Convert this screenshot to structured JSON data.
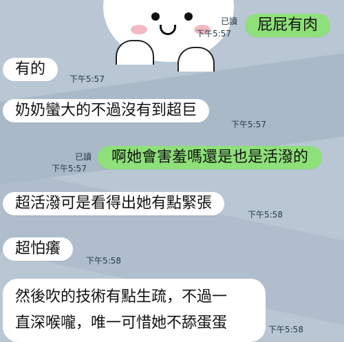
{
  "chat": {
    "messages": [
      {
        "id": "m1",
        "direction": "out",
        "text": "屁屁有肉",
        "read": "已讀",
        "time": "下午5:57"
      },
      {
        "id": "m2",
        "direction": "in",
        "text": "有的",
        "time": "下午5:57"
      },
      {
        "id": "m3",
        "direction": "in",
        "text": "奶奶蠻大的不過沒有到超巨",
        "time": "下午5:57"
      },
      {
        "id": "m4",
        "direction": "out",
        "text": "啊她會害羞嗎還是也是活潑的",
        "read": "已讀",
        "time": "下午5:57"
      },
      {
        "id": "m5",
        "direction": "in",
        "text": "超活潑可是看得出她有點緊張",
        "time": "下午5:58"
      },
      {
        "id": "m6",
        "direction": "in",
        "text": "超怕癢",
        "time": "下午5:58"
      },
      {
        "id": "m7",
        "direction": "in",
        "lines": [
          "然後吹的技術有點生疏，不過一",
          "直深喉嚨，唯一可惜她不舔蛋蛋"
        ],
        "time": "下午5:58"
      }
    ]
  },
  "colors": {
    "background": "#b9c7d4",
    "incoming_bubble": "#ffffff",
    "outgoing_bubble": "#8ee07a",
    "meta_text": "#25394a"
  },
  "wallpaper": {
    "sticker": "cony-bunny-sticker-icon"
  }
}
